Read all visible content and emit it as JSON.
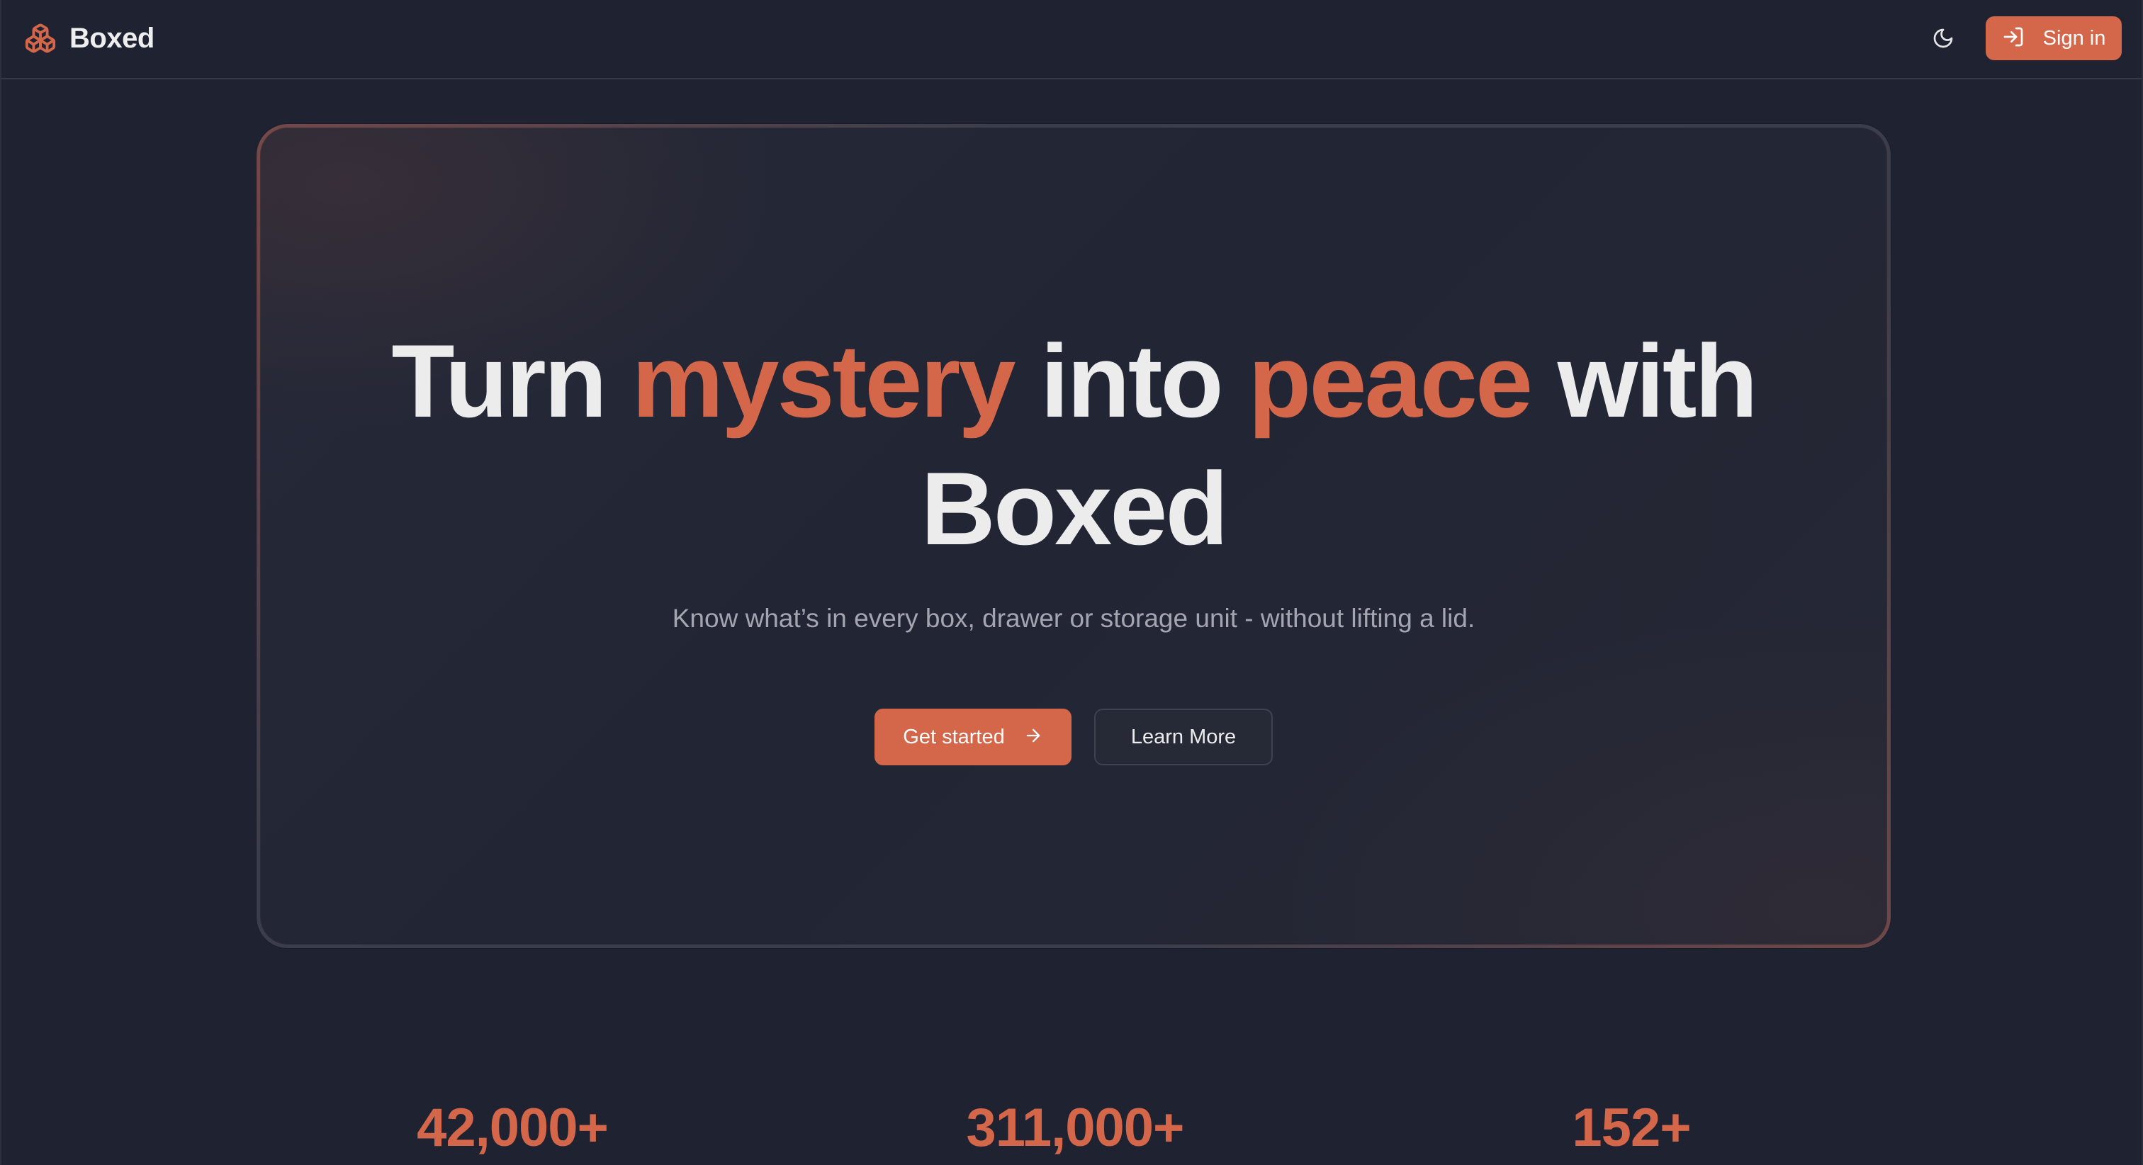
{
  "brand": {
    "name": "Boxed",
    "logo_icon": "boxes-icon",
    "accent_color": "#d4664a"
  },
  "nav": {
    "theme_toggle_icon": "moon-icon",
    "signin_icon": "log-in-icon",
    "signin_label": "Sign in"
  },
  "hero": {
    "title_part1": "Turn ",
    "title_accent1": "mystery",
    "title_part2": " into ",
    "title_accent2": "peace",
    "title_part3": " with",
    "title_line2": "Boxed",
    "subtitle": "Know what’s in every box, drawer or storage unit - without lifting a lid.",
    "primary_cta": "Get started",
    "primary_cta_icon": "arrow-right-icon",
    "secondary_cta": "Learn More"
  },
  "stats": [
    {
      "value": "42,000+"
    },
    {
      "value": "311,000+"
    },
    {
      "value": "152+"
    }
  ],
  "colors": {
    "background": "#1f2331",
    "accent": "#d4664a",
    "text": "#ececec",
    "muted_text": "#a3a6b1"
  }
}
